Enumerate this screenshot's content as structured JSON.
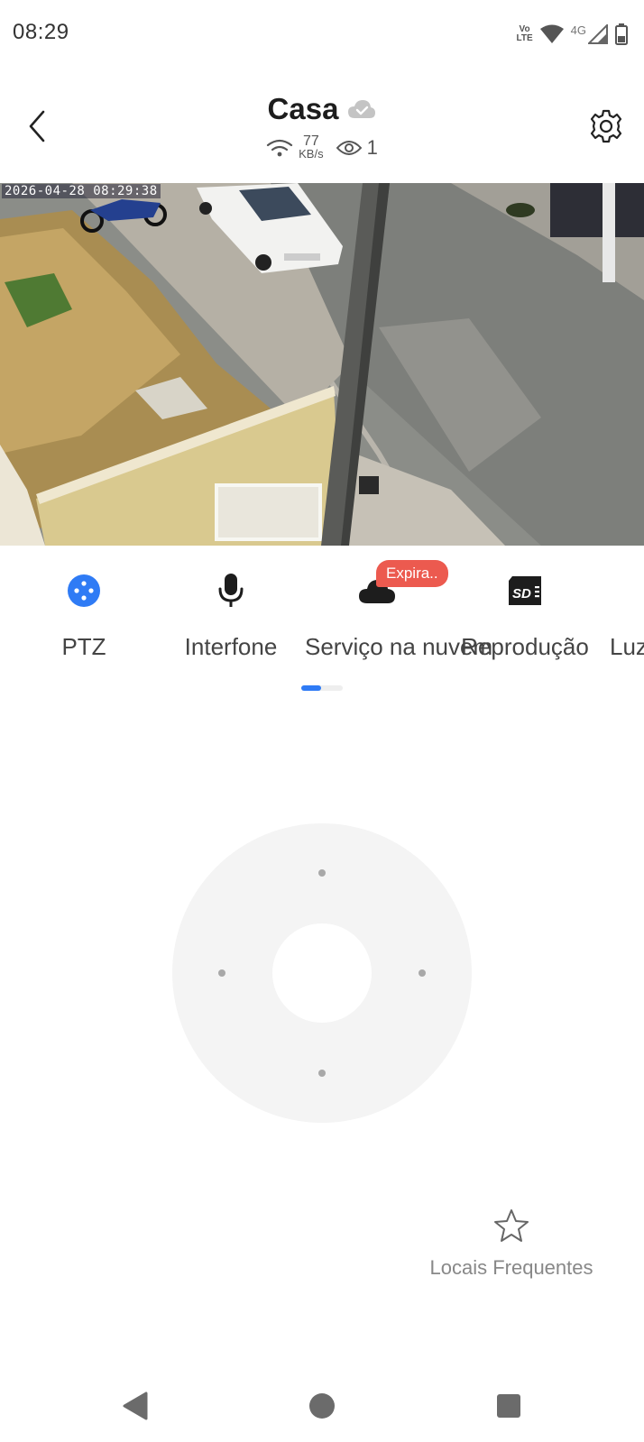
{
  "status_bar": {
    "time": "08:29",
    "volte_top": "Vo",
    "volte_bottom": "LTE",
    "network": "4G",
    "icons": [
      "volte-icon",
      "wifi-icon",
      "signal-icon",
      "battery-icon"
    ]
  },
  "header": {
    "title": "Casa",
    "speed_value": "77",
    "speed_unit": "KB/s",
    "viewers": "1",
    "icons": [
      "back-icon",
      "cloud-status-icon",
      "wifi-icon",
      "eye-icon",
      "gear-icon"
    ]
  },
  "video": {
    "timestamp": "2026-04-28  08:29:38"
  },
  "tools": [
    {
      "label": "PTZ",
      "icon": "ptz-icon",
      "color": "#2f7bf5"
    },
    {
      "label": "Interfone",
      "icon": "microphone-icon"
    },
    {
      "label": "Serviço na nuvem",
      "icon": "cloud-icon",
      "badge": "Expira.."
    },
    {
      "label": "Reprodução",
      "icon": "sd-card-icon"
    },
    {
      "label": "Luz",
      "icon": "light-icon"
    }
  ],
  "ptz": {
    "directions": [
      "up",
      "left",
      "right",
      "down"
    ]
  },
  "favorites": {
    "label": "Locais Frequentes",
    "icon": "star-icon"
  },
  "colors": {
    "accent": "#2f7bf5",
    "badge": "#ec5a4f",
    "pad": "#f4f4f4"
  }
}
